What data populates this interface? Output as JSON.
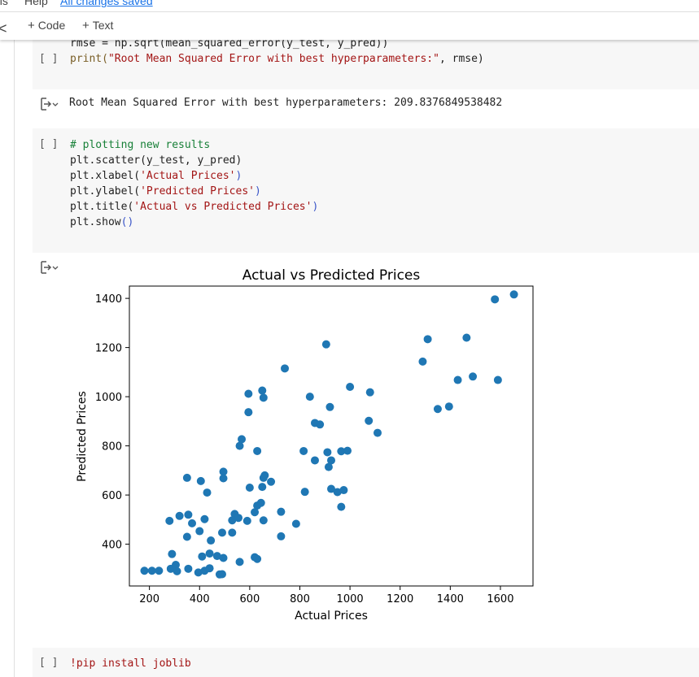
{
  "menu": {
    "items": [
      "ols",
      "Help"
    ],
    "saved_status": "All changes saved"
  },
  "toolbar": {
    "back_glyph": "<",
    "add_code": "Code",
    "add_text": "Text",
    "plus_glyph": "+"
  },
  "cells": {
    "rmse_cell": {
      "bracket": "[ ]",
      "line1": "rmse = np.sqrt(mean_squared_error(y_test, y_pred))",
      "line2_fn": "print(",
      "line2_str": "\"Root Mean Squared Error with best hyperparameters:\"",
      "line2_rest": ", rmse)"
    },
    "rmse_output": "Root Mean Squared Error with best hyperparameters: 209.8376849538482",
    "plot_cell": {
      "bracket": "[ ]",
      "comment": "# plotting new results",
      "l1_a": "plt.scatter(y_test, y_pred)",
      "l2_a": "plt.xlabel(",
      "l2_s": "'Actual Prices'",
      "l2_b": ")",
      "l3_a": "plt.ylabel(",
      "l3_s": "'Predicted Prices'",
      "l3_b": ")",
      "l4_a": "plt.title(",
      "l4_s": "'Actual vs Predicted Prices'",
      "l4_b": ")",
      "l5_a": "plt.show",
      "l5_b": "()"
    },
    "pip_cell": {
      "bracket": "[ ]",
      "code": "!pip install joblib"
    }
  },
  "colors": {
    "point": "#1f77b4",
    "cell_bg": "#f7f7f7",
    "link": "#1a73e8"
  },
  "icons": [
    "chevron-left-icon",
    "output-toggle-icon"
  ],
  "chart_data": {
    "type": "scatter",
    "title": "Actual vs Predicted Prices",
    "xlabel": "Actual Prices",
    "ylabel": "Predicted Prices",
    "xlim": [
      120,
      1730
    ],
    "ylim": [
      230,
      1450
    ],
    "xticks": [
      200,
      400,
      600,
      800,
      1000,
      1200,
      1400,
      1600
    ],
    "yticks": [
      400,
      600,
      800,
      1000,
      1200,
      1400
    ],
    "grid": false,
    "points": [
      [
        1654,
        1416
      ],
      [
        1578,
        1396
      ],
      [
        1310,
        1234
      ],
      [
        1465,
        1240
      ],
      [
        1290,
        1143
      ],
      [
        1430,
        1068
      ],
      [
        1490,
        1082
      ],
      [
        1590,
        1068
      ],
      [
        1395,
        960
      ],
      [
        1350,
        950
      ],
      [
        905,
        1213
      ],
      [
        740,
        1115
      ],
      [
        1000,
        1040
      ],
      [
        1080,
        1018
      ],
      [
        595,
        1012
      ],
      [
        650,
        1025
      ],
      [
        655,
        996
      ],
      [
        840,
        1000
      ],
      [
        595,
        937
      ],
      [
        920,
        958
      ],
      [
        1075,
        902
      ],
      [
        1110,
        853
      ],
      [
        860,
        893
      ],
      [
        880,
        887
      ],
      [
        568,
        827
      ],
      [
        560,
        800
      ],
      [
        630,
        779
      ],
      [
        815,
        779
      ],
      [
        910,
        774
      ],
      [
        965,
        778
      ],
      [
        990,
        780
      ],
      [
        860,
        741
      ],
      [
        925,
        741
      ],
      [
        915,
        714
      ],
      [
        350,
        670
      ],
      [
        405,
        657
      ],
      [
        495,
        695
      ],
      [
        495,
        668
      ],
      [
        660,
        680
      ],
      [
        655,
        670
      ],
      [
        685,
        654
      ],
      [
        650,
        633
      ],
      [
        430,
        610
      ],
      [
        600,
        630
      ],
      [
        820,
        613
      ],
      [
        925,
        625
      ],
      [
        950,
        612
      ],
      [
        975,
        620
      ],
      [
        965,
        552
      ],
      [
        355,
        520
      ],
      [
        320,
        515
      ],
      [
        540,
        523
      ],
      [
        280,
        495
      ],
      [
        370,
        485
      ],
      [
        420,
        502
      ],
      [
        530,
        497
      ],
      [
        555,
        507
      ],
      [
        590,
        495
      ],
      [
        655,
        497
      ],
      [
        630,
        557
      ],
      [
        645,
        568
      ],
      [
        620,
        530
      ],
      [
        725,
        532
      ],
      [
        350,
        430
      ],
      [
        400,
        453
      ],
      [
        445,
        415
      ],
      [
        490,
        447
      ],
      [
        530,
        447
      ],
      [
        725,
        432
      ],
      [
        785,
        483
      ],
      [
        290,
        360
      ],
      [
        410,
        350
      ],
      [
        440,
        362
      ],
      [
        470,
        352
      ],
      [
        495,
        344
      ],
      [
        560,
        328
      ],
      [
        620,
        347
      ],
      [
        630,
        340
      ],
      [
        180,
        292
      ],
      [
        210,
        292
      ],
      [
        238,
        292
      ],
      [
        285,
        300
      ],
      [
        305,
        316
      ],
      [
        310,
        290
      ],
      [
        355,
        300
      ],
      [
        395,
        285
      ],
      [
        420,
        292
      ],
      [
        440,
        302
      ],
      [
        480,
        277
      ],
      [
        490,
        278
      ]
    ]
  }
}
